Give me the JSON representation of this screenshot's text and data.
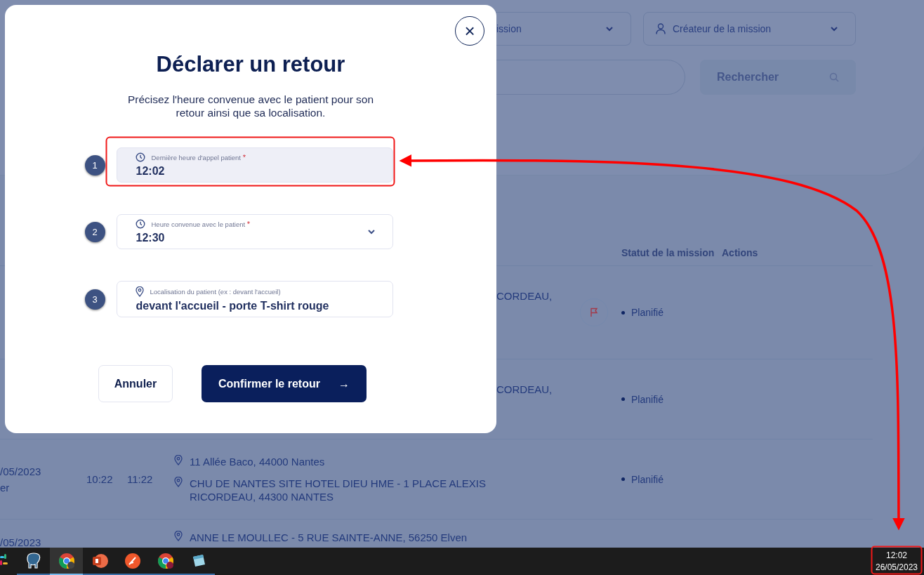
{
  "filters": {
    "mission_dropdown": "ission",
    "creator_dropdown": "Créateur de la mission",
    "search_button": "Rechercher"
  },
  "table": {
    "columns": [
      "Statut de la mission",
      "Actions"
    ],
    "rows": [
      {
        "address_fragment": "CORDEAU,",
        "flagged": true,
        "status": "Planifié"
      },
      {
        "address_fragment": "CORDEAU,",
        "flagged": false,
        "status": "Planifié"
      },
      {
        "date": "/05/2023",
        "date_sub": "er",
        "start": "10:22",
        "end": "11:22",
        "pickup": "11 Allée Baco, 44000 Nantes",
        "dropoff": "CHU DE NANTES SITE HOTEL DIEU HME - 1 PLACE ALEXIS RICORDEAU, 44300 NANTES",
        "flagged": false,
        "status": "Planifié"
      },
      {
        "date": "/05/2023",
        "pickup": "ANNE LE MOULLEC - 5 RUE SAINTE-ANNE, 56250 Elven"
      }
    ]
  },
  "modal": {
    "close": "×",
    "title": "Déclarer un retour",
    "description": "Précisez l'heure convenue avec le patient pour son retour ainsi que sa localisation.",
    "fields": [
      {
        "number": "1",
        "kind": "time",
        "label": "Dernière heure d'appel patient",
        "required_mark": "*",
        "value": "12:02",
        "highlighted": true
      },
      {
        "number": "2",
        "kind": "select",
        "label": "Heure convenue avec le patient",
        "required_mark": "*",
        "value": "12:30",
        "highlighted": false
      },
      {
        "number": "3",
        "kind": "location",
        "label": "Localisation du patient (ex : devant l'accueil)",
        "value": "devant l'accueil - porte T-shirt rouge",
        "highlighted": false
      }
    ],
    "cancel": "Annuler",
    "confirm": "Confirmer le retour",
    "confirm_arrow": "→"
  },
  "taskbar": {
    "apps": [
      {
        "kind": "slack",
        "selected": false
      },
      {
        "kind": "database",
        "selected": false
      },
      {
        "kind": "chrome",
        "selected": true
      },
      {
        "kind": "powerpoint",
        "selected": false
      },
      {
        "kind": "paint",
        "selected": false
      },
      {
        "kind": "chrome-profile",
        "selected": false
      },
      {
        "kind": "notepad",
        "selected": false
      }
    ],
    "time": "12:02",
    "date": "26/05/2023"
  }
}
